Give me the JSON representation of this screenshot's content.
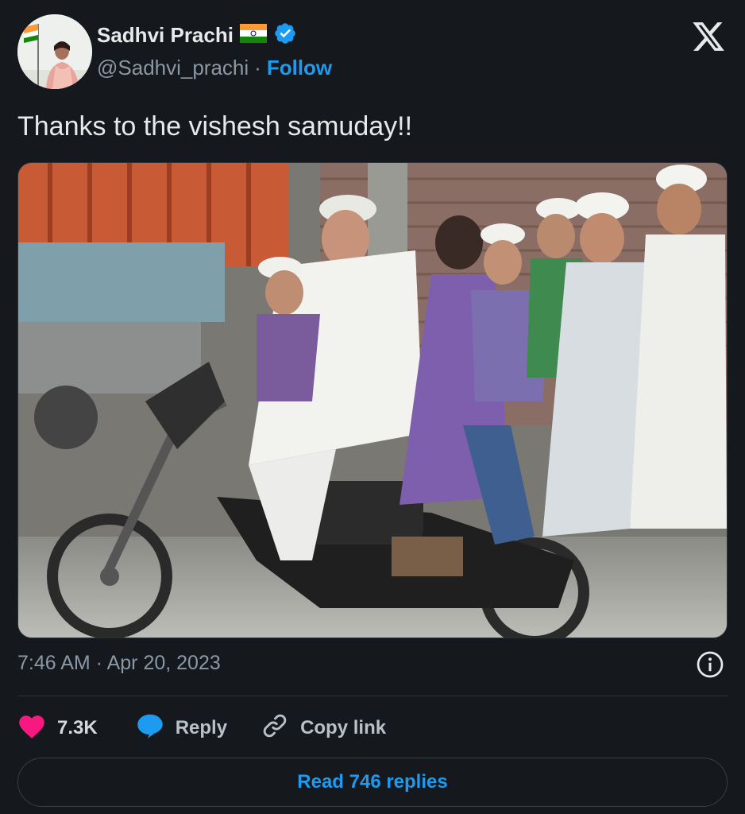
{
  "author": {
    "name": "Sadhvi Prachi",
    "handle": "@Sadhvi_prachi",
    "follow_label": "Follow",
    "separator": "·"
  },
  "tweet": {
    "text": "Thanks to the vishesh samuday!!",
    "time": "7:46 AM",
    "date_separator": "·",
    "date": "Apr 20, 2023"
  },
  "actions": {
    "likes": "7.3K",
    "reply_label": "Reply",
    "copy_link_label": "Copy link"
  },
  "read_replies_label": "Read 746 replies",
  "icons": [
    "x-logo-icon",
    "verified-badge-icon",
    "india-flag-icon",
    "info-icon",
    "heart-icon",
    "reply-bubble-icon",
    "link-icon"
  ],
  "colors": {
    "accent": "#1d9bf0",
    "like": "#f91880",
    "background": "#15181c"
  }
}
